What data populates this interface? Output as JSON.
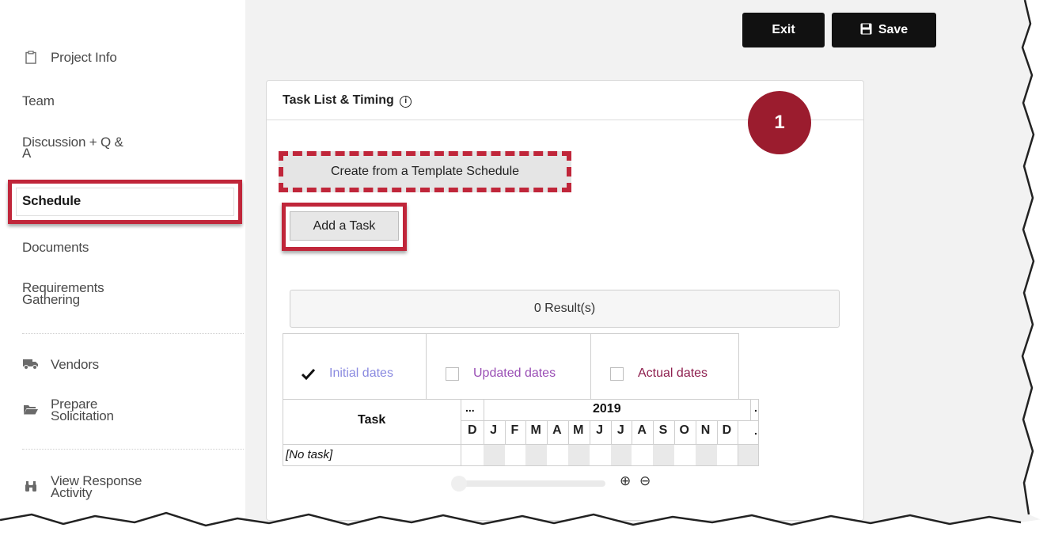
{
  "sidebar": {
    "items": [
      {
        "label": "Project Info",
        "icon": "clipboard-icon"
      },
      {
        "label": "Team"
      },
      {
        "label_line1": "Discussion + Q &",
        "label_line2": "A"
      },
      {
        "label": "Schedule",
        "active": true
      },
      {
        "label": "Documents"
      },
      {
        "label_line1": "Requirements",
        "label_line2": "Gathering"
      },
      {
        "label": "Vendors",
        "icon": "truck-icon"
      },
      {
        "label_line1": "Prepare",
        "label_line2": "Solicitation",
        "icon": "folder-open-icon"
      },
      {
        "label_line1": "View Response",
        "label_line2": "Activity",
        "icon": "binoculars-icon"
      }
    ]
  },
  "toolbar": {
    "exit_label": "Exit",
    "save_label": "Save"
  },
  "panel": {
    "title": "Task List & Timing",
    "info_glyph": "i",
    "step_badge": "1",
    "template_button": "Create from a Template Schedule",
    "add_task_button": "Add a Task",
    "results_text": "0 Result(s)",
    "legend": {
      "initial": {
        "label": "Initial dates",
        "checked": true,
        "color": "#8a8ae0"
      },
      "updated": {
        "label": "Updated dates",
        "checked": false,
        "color": "#9a4fb5"
      },
      "actual": {
        "label": "Actual dates",
        "checked": false,
        "color": "#8e1f4e"
      }
    },
    "gantt": {
      "task_header": "Task",
      "prev_marker": "...",
      "next_marker": ".",
      "next_marker_bottom": ".",
      "year": "2019",
      "months": [
        "D",
        "J",
        "F",
        "M",
        "A",
        "M",
        "J",
        "J",
        "A",
        "S",
        "O",
        "N",
        "D"
      ],
      "empty_row": "[No task]"
    },
    "zoom_in_glyph": "⊕",
    "zoom_out_glyph": "⊖"
  },
  "colors": {
    "highlight": "#c0263a",
    "badge": "#9b1c2e"
  }
}
